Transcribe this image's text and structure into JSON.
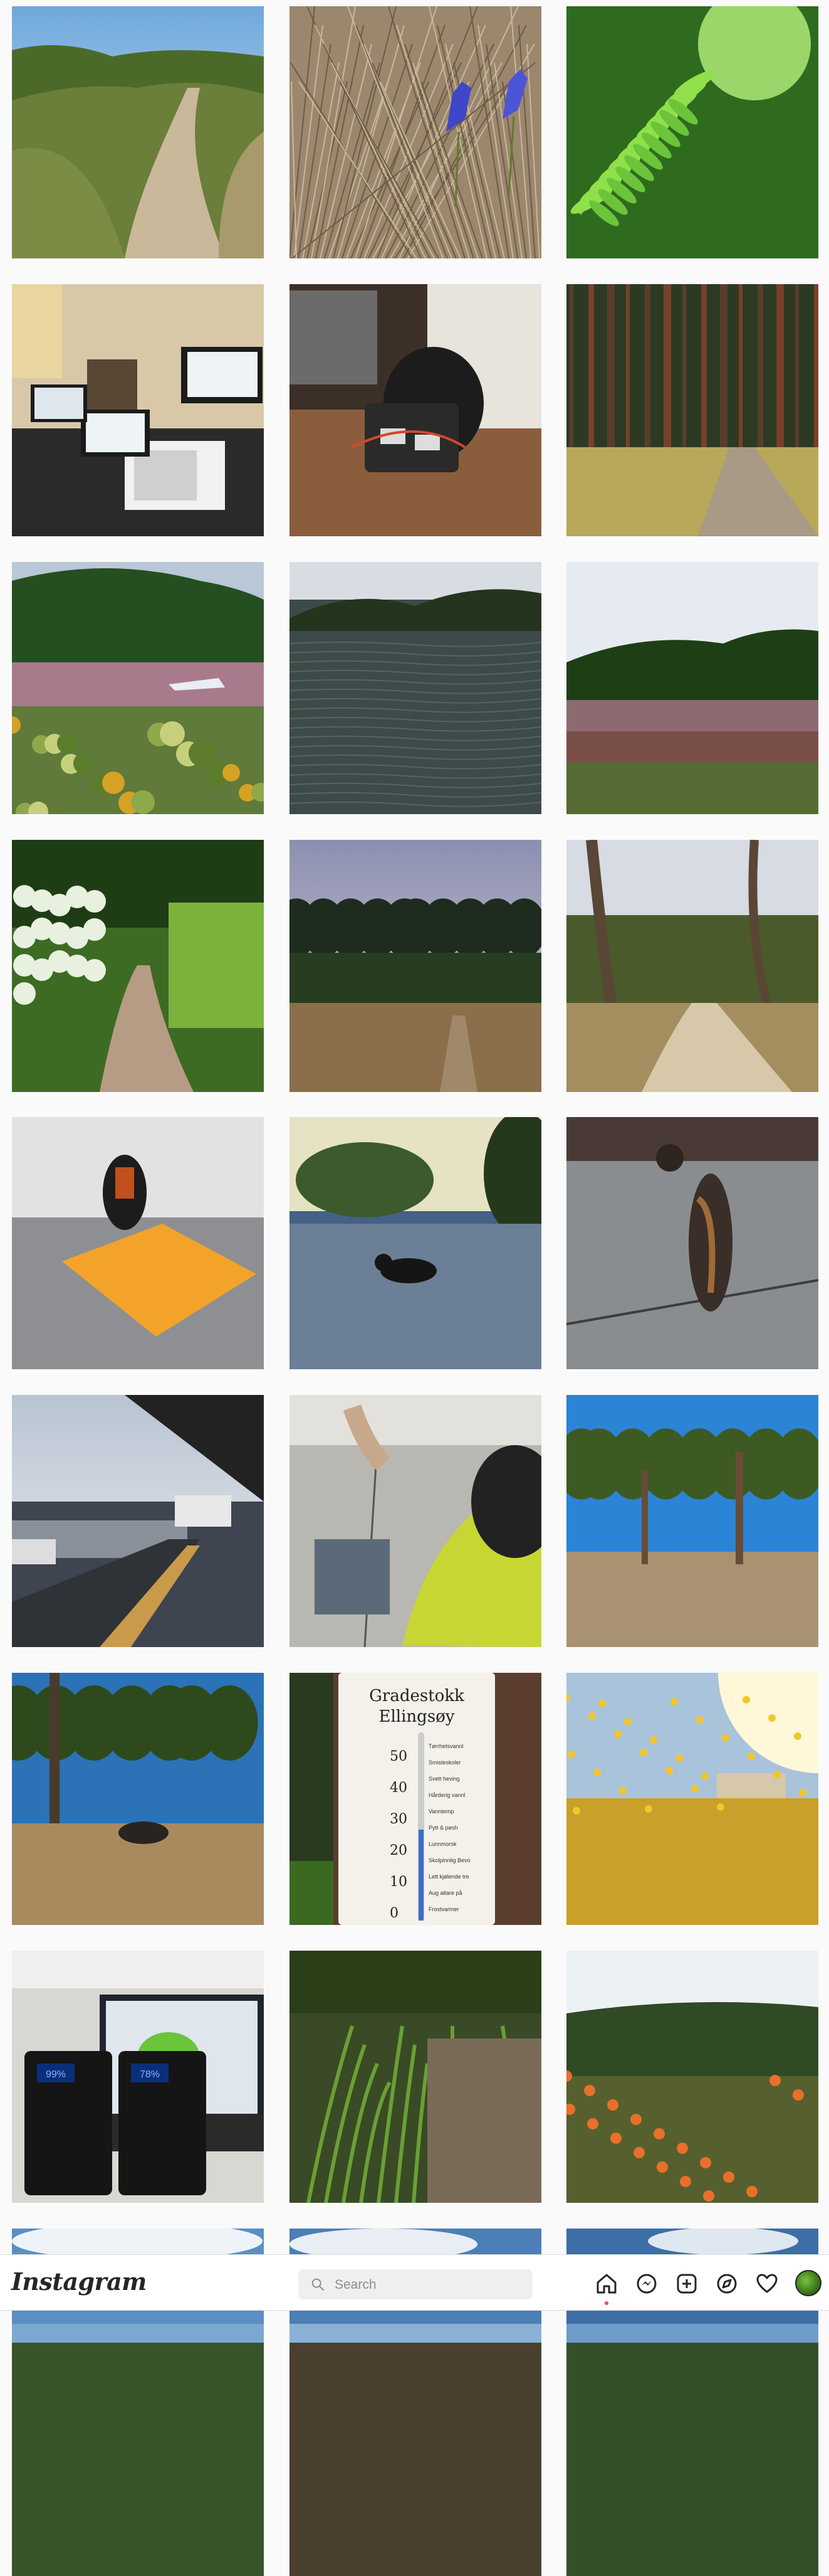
{
  "header": {
    "logo": "Instagram",
    "search": {
      "placeholder": "Search"
    },
    "nav": [
      "home-icon",
      "messenger-icon",
      "new-post-icon",
      "explore-icon",
      "activity-heart-icon",
      "profile-avatar"
    ]
  },
  "posts": [
    {
      "name": "dirt-road-hills"
    },
    {
      "name": "blue-wildflowers-dry-grass"
    },
    {
      "name": "green-fern-leaves"
    },
    {
      "name": "laptops-and-microwave"
    },
    {
      "name": "backpack-gear-on-floor"
    },
    {
      "name": "eucalyptus-forest-trail"
    },
    {
      "name": "hills-over-reservoir"
    },
    {
      "name": "lake-water-surface"
    },
    {
      "name": "green-hills-meadow"
    },
    {
      "name": "trail-with-white-flowers"
    },
    {
      "name": "dusk-trees-meadow"
    },
    {
      "name": "oak-woodland-path"
    },
    {
      "name": "backpack-with-orange-tarp"
    },
    {
      "name": "black-cat-on-driveway"
    },
    {
      "name": "tortoiseshell-cat-stretching"
    },
    {
      "name": "train-platform-freeway"
    },
    {
      "name": "bart-train-interior"
    },
    {
      "name": "park-with-tall-trees"
    },
    {
      "name": "dog-running-in-park"
    },
    {
      "name": "gradestokk-thermometer"
    },
    {
      "name": "yellow-flowers-sunlight"
    },
    {
      "name": "power-banks-and-laptop"
    },
    {
      "name": "fern-forest-floor"
    },
    {
      "name": "hillside-orange-flowers"
    },
    {
      "name": "sky-clouds-partial"
    },
    {
      "name": "sky-clouds-partial-2"
    },
    {
      "name": "sky-clouds-partial-3"
    },
    {
      "name": "partial-row-bottom-1"
    },
    {
      "name": "partial-row-bottom-2"
    },
    {
      "name": "partial-row-bottom-3"
    }
  ],
  "thermometer": {
    "title1": "Gradestokk",
    "title2": "Ellingsøy",
    "ticks": [
      "50",
      "40",
      "30",
      "20",
      "10",
      "0"
    ],
    "legend": [
      "Tørrhetsvannl",
      "Smisteskoler",
      "Svett heving",
      "Hårderig vannl",
      "Vanntemp",
      "Pytt & pøsh",
      "Lunnmorsk",
      "Skolpinnlig Bevo",
      "Lett kjølende tre",
      "Aug altare på",
      "Frostvarmer"
    ]
  },
  "powerbank": {
    "left_display": "99%",
    "right_display": "78%"
  },
  "colors": {
    "nav_icon": "#262626",
    "notification_dot": "#ed4956",
    "search_bg": "#efefef"
  }
}
